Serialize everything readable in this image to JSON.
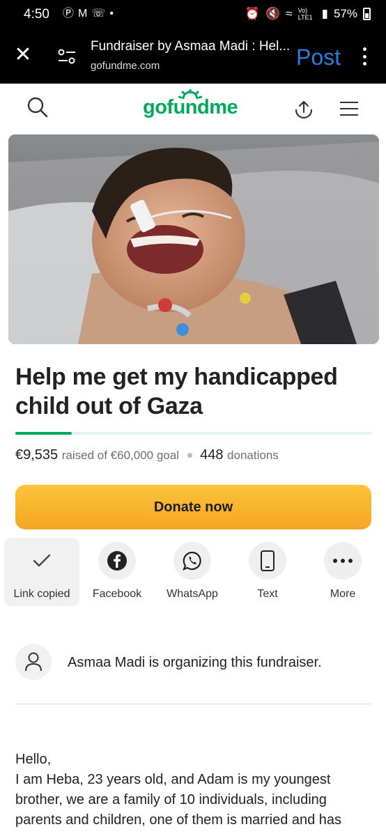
{
  "status_bar": {
    "time": "4:50",
    "network": "Vo) LTE1",
    "battery": "57%"
  },
  "browser": {
    "page_title": "Fundraiser by Asmaa Madi : Hel...",
    "domain": "gofundme.com",
    "post_label": "Post"
  },
  "header": {
    "logo": "gofundme"
  },
  "campaign": {
    "title": "Help me get my handicapped child out of Gaza",
    "raised": "€9,535",
    "raised_suffix": "raised of €60,000 goal",
    "donations_count": "448",
    "donations_label": "donations",
    "progress_fraction": 0.159,
    "donate_label": "Donate now"
  },
  "share": {
    "items": [
      {
        "label": "Link copied",
        "icon": "checkmark-icon"
      },
      {
        "label": "Facebook",
        "icon": "facebook-icon"
      },
      {
        "label": "WhatsApp",
        "icon": "whatsapp-icon"
      },
      {
        "label": "Text",
        "icon": "phone-icon"
      },
      {
        "label": "More",
        "icon": "more-dots-icon"
      }
    ]
  },
  "organizer": {
    "text": "Asmaa Madi is organizing this fundraiser."
  },
  "story": {
    "lines": [
      "Hello,",
      "I am Heba, 23 years old, and Adam is my youngest",
      "brother, we are a family of 10 individuals, including",
      "parents and children, one of them is married and has"
    ]
  },
  "colors": {
    "brand_green": "#02a95c",
    "donate_orange": "#f5a524",
    "post_blue": "#2b7de0"
  }
}
